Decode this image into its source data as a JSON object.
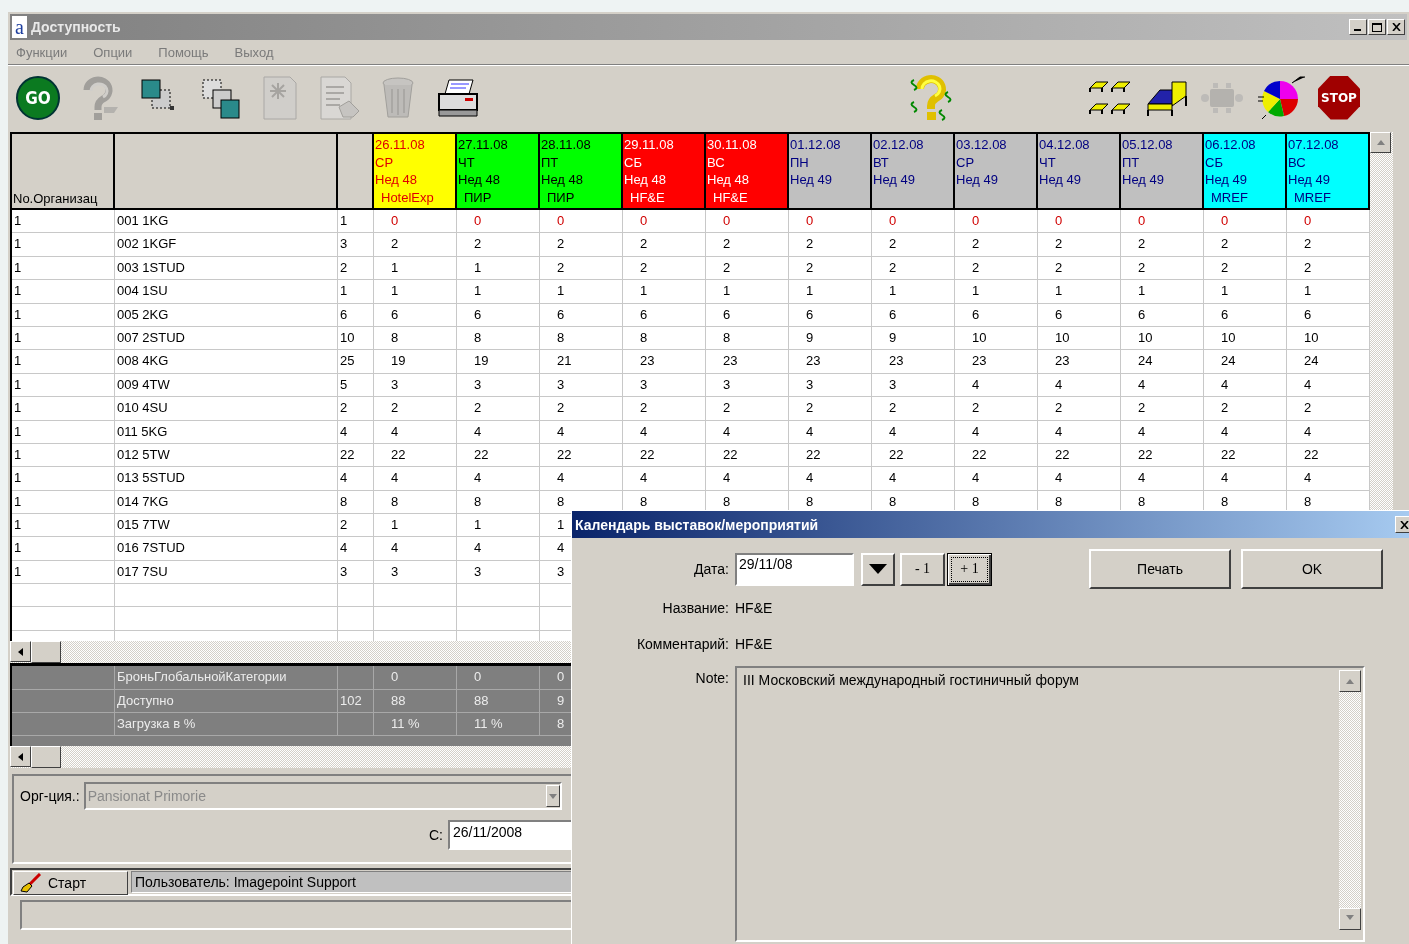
{
  "window": {
    "logo": "a",
    "title": "Доступность"
  },
  "menu": [
    {
      "label": "Функции",
      "disabled": true
    },
    {
      "label": "Опции",
      "disabled": true
    },
    {
      "label": "Помощь",
      "disabled": true
    },
    {
      "label": "Выход",
      "disabled": true
    }
  ],
  "toolbar": {
    "left": [
      {
        "kind": "go",
        "label": "GO",
        "disabled": false
      },
      {
        "kind": "help",
        "disabled": true
      },
      {
        "kind": "copy",
        "disabled": false
      },
      {
        "kind": "move",
        "disabled": false
      },
      {
        "kind": "new",
        "disabled": true
      },
      {
        "kind": "document",
        "disabled": true
      },
      {
        "kind": "trash",
        "disabled": true
      },
      {
        "kind": "printer",
        "disabled": false
      }
    ],
    "middle": [
      {
        "kind": "money-help",
        "disabled": false
      }
    ],
    "right": [
      {
        "kind": "beds",
        "disabled": false
      },
      {
        "kind": "bed",
        "disabled": false
      },
      {
        "kind": "table",
        "disabled": true
      },
      {
        "kind": "pie",
        "disabled": false
      },
      {
        "kind": "stop",
        "label": "STOP",
        "disabled": false
      }
    ]
  },
  "grid": {
    "column_1": "No.Организац",
    "dates": [
      {
        "date": "26.11.08",
        "weekday": "СР",
        "week": "Нед 48",
        "event": "HotelExp",
        "color": "#ffff00"
      },
      {
        "date": "27.11.08",
        "weekday": "ЧТ",
        "week": "Нед 48",
        "event": "ПИР",
        "color": "#00ff00"
      },
      {
        "date": "28.11.08",
        "weekday": "ПТ",
        "week": "Нед 48",
        "event": "ПИР",
        "color": "#00ff00"
      },
      {
        "date": "29.11.08",
        "weekday": "СБ",
        "week": "Нед 48",
        "event": "HF&E",
        "color": "#ff0000"
      },
      {
        "date": "30.11.08",
        "weekday": "ВС",
        "week": "Нед 48",
        "event": "HF&E",
        "color": "#ff0000"
      },
      {
        "date": "01.12.08",
        "weekday": "ПН",
        "week": "Нед 49",
        "color": "#c0c0c0"
      },
      {
        "date": "02.12.08",
        "weekday": "ВТ",
        "week": "Нед 49",
        "color": "#c0c0c0"
      },
      {
        "date": "03.12.08",
        "weekday": "СР",
        "week": "Нед 49",
        "color": "#c0c0c0"
      },
      {
        "date": "04.12.08",
        "weekday": "ЧТ",
        "week": "Нед 49",
        "color": "#c0c0c0"
      },
      {
        "date": "05.12.08",
        "weekday": "ПТ",
        "week": "Нед 49",
        "color": "#c0c0c0"
      },
      {
        "date": "06.12.08",
        "weekday": "СБ",
        "week": "Нед 49",
        "event": "MREF",
        "color": "#00ffff"
      },
      {
        "date": "07.12.08",
        "weekday": "ВС",
        "week": "Нед 49",
        "event": "MREF",
        "color": "#00ffff"
      }
    ],
    "rows": [
      {
        "org": "1",
        "room": "001 1KG",
        "total": "1",
        "alert": true,
        "values": [
          "0",
          "0",
          "0",
          "0",
          "0",
          "0",
          "0",
          "0",
          "0",
          "0",
          "0",
          "0"
        ]
      },
      {
        "org": "1",
        "room": "002 1KGF",
        "total": "3",
        "alert": false,
        "values": [
          "2",
          "2",
          "2",
          "2",
          "2",
          "2",
          "2",
          "2",
          "2",
          "2",
          "2",
          "2"
        ]
      },
      {
        "org": "1",
        "room": "003 1STUD",
        "total": "2",
        "alert": false,
        "values": [
          "1",
          "1",
          "2",
          "2",
          "2",
          "2",
          "2",
          "2",
          "2",
          "2",
          "2",
          "2"
        ]
      },
      {
        "org": "1",
        "room": "004 1SU",
        "total": "1",
        "alert": false,
        "values": [
          "1",
          "1",
          "1",
          "1",
          "1",
          "1",
          "1",
          "1",
          "1",
          "1",
          "1",
          "1"
        ]
      },
      {
        "org": "1",
        "room": "005 2KG",
        "total": "6",
        "alert": false,
        "values": [
          "6",
          "6",
          "6",
          "6",
          "6",
          "6",
          "6",
          "6",
          "6",
          "6",
          "6",
          "6"
        ]
      },
      {
        "org": "1",
        "room": "007 2STUD",
        "total": "10",
        "alert": false,
        "values": [
          "8",
          "8",
          "8",
          "8",
          "8",
          "9",
          "9",
          "10",
          "10",
          "10",
          "10",
          "10"
        ]
      },
      {
        "org": "1",
        "room": "008 4KG",
        "total": "25",
        "alert": false,
        "values": [
          "19",
          "19",
          "21",
          "23",
          "23",
          "23",
          "23",
          "23",
          "23",
          "24",
          "24",
          "24"
        ]
      },
      {
        "org": "1",
        "room": "009 4TW",
        "total": "5",
        "alert": false,
        "values": [
          "3",
          "3",
          "3",
          "3",
          "3",
          "3",
          "3",
          "4",
          "4",
          "4",
          "4",
          "4"
        ]
      },
      {
        "org": "1",
        "room": "010 4SU",
        "total": "2",
        "alert": false,
        "values": [
          "2",
          "2",
          "2",
          "2",
          "2",
          "2",
          "2",
          "2",
          "2",
          "2",
          "2",
          "2"
        ]
      },
      {
        "org": "1",
        "room": "011 5KG",
        "total": "4",
        "alert": false,
        "values": [
          "4",
          "4",
          "4",
          "4",
          "4",
          "4",
          "4",
          "4",
          "4",
          "4",
          "4",
          "4"
        ]
      },
      {
        "org": "1",
        "room": "012 5TW",
        "total": "22",
        "alert": false,
        "values": [
          "22",
          "22",
          "22",
          "22",
          "22",
          "22",
          "22",
          "22",
          "22",
          "22",
          "22",
          "22"
        ]
      },
      {
        "org": "1",
        "room": "013 5STUD",
        "total": "4",
        "alert": false,
        "values": [
          "4",
          "4",
          "4",
          "4",
          "4",
          "4",
          "4",
          "4",
          "4",
          "4",
          "4",
          "4"
        ]
      },
      {
        "org": "1",
        "room": "014 7KG",
        "total": "8",
        "alert": false,
        "values": [
          "8",
          "8",
          "8",
          "8",
          "8",
          "8",
          "8",
          "8",
          "8",
          "8",
          "8",
          "8"
        ]
      },
      {
        "org": "1",
        "room": "015 7TW",
        "total": "2",
        "alert": false,
        "values": [
          "1",
          "1",
          "1"
        ]
      },
      {
        "org": "1",
        "room": "016 7STUD",
        "total": "4",
        "alert": false,
        "values": [
          "4",
          "4",
          "4"
        ]
      },
      {
        "org": "1",
        "room": "017 7SU",
        "total": "3",
        "alert": false,
        "values": [
          "3",
          "3",
          "3"
        ]
      }
    ],
    "summary": [
      {
        "label": "БроньГлобальнойКатегории",
        "values": [
          "0",
          "0",
          "0"
        ]
      },
      {
        "label": "Доступно",
        "total": "102",
        "values": [
          "88",
          "88",
          "9"
        ]
      },
      {
        "label": "Загрузка в %",
        "values": [
          "11 %",
          "11 %",
          "8"
        ]
      }
    ]
  },
  "filter": {
    "org_label": "Орг-ция.:",
    "org_value": "Pansionat Primorie",
    "org_disabled": true,
    "from_label": "С:",
    "from_value": "26/11/2008"
  },
  "status": {
    "start": "Старт",
    "user": "Пользователь: Imagepoint Support"
  },
  "dialog": {
    "title": "Календарь выставок/мероприятий",
    "date_label": "Дата:",
    "date_value": "29/11/08",
    "steps": [
      {
        "label": "- 1",
        "focused": false
      },
      {
        "label": "+ 1",
        "focused": true
      }
    ],
    "actions": [
      {
        "label": "Печать"
      },
      {
        "label": "OK"
      }
    ],
    "fields": [
      {
        "label": "Название:",
        "value": "HF&E"
      },
      {
        "label": "Комментарий:",
        "value": "HF&E"
      }
    ],
    "note": {
      "label": "Note:",
      "value": "III Московский международный гостиничный форум"
    }
  }
}
